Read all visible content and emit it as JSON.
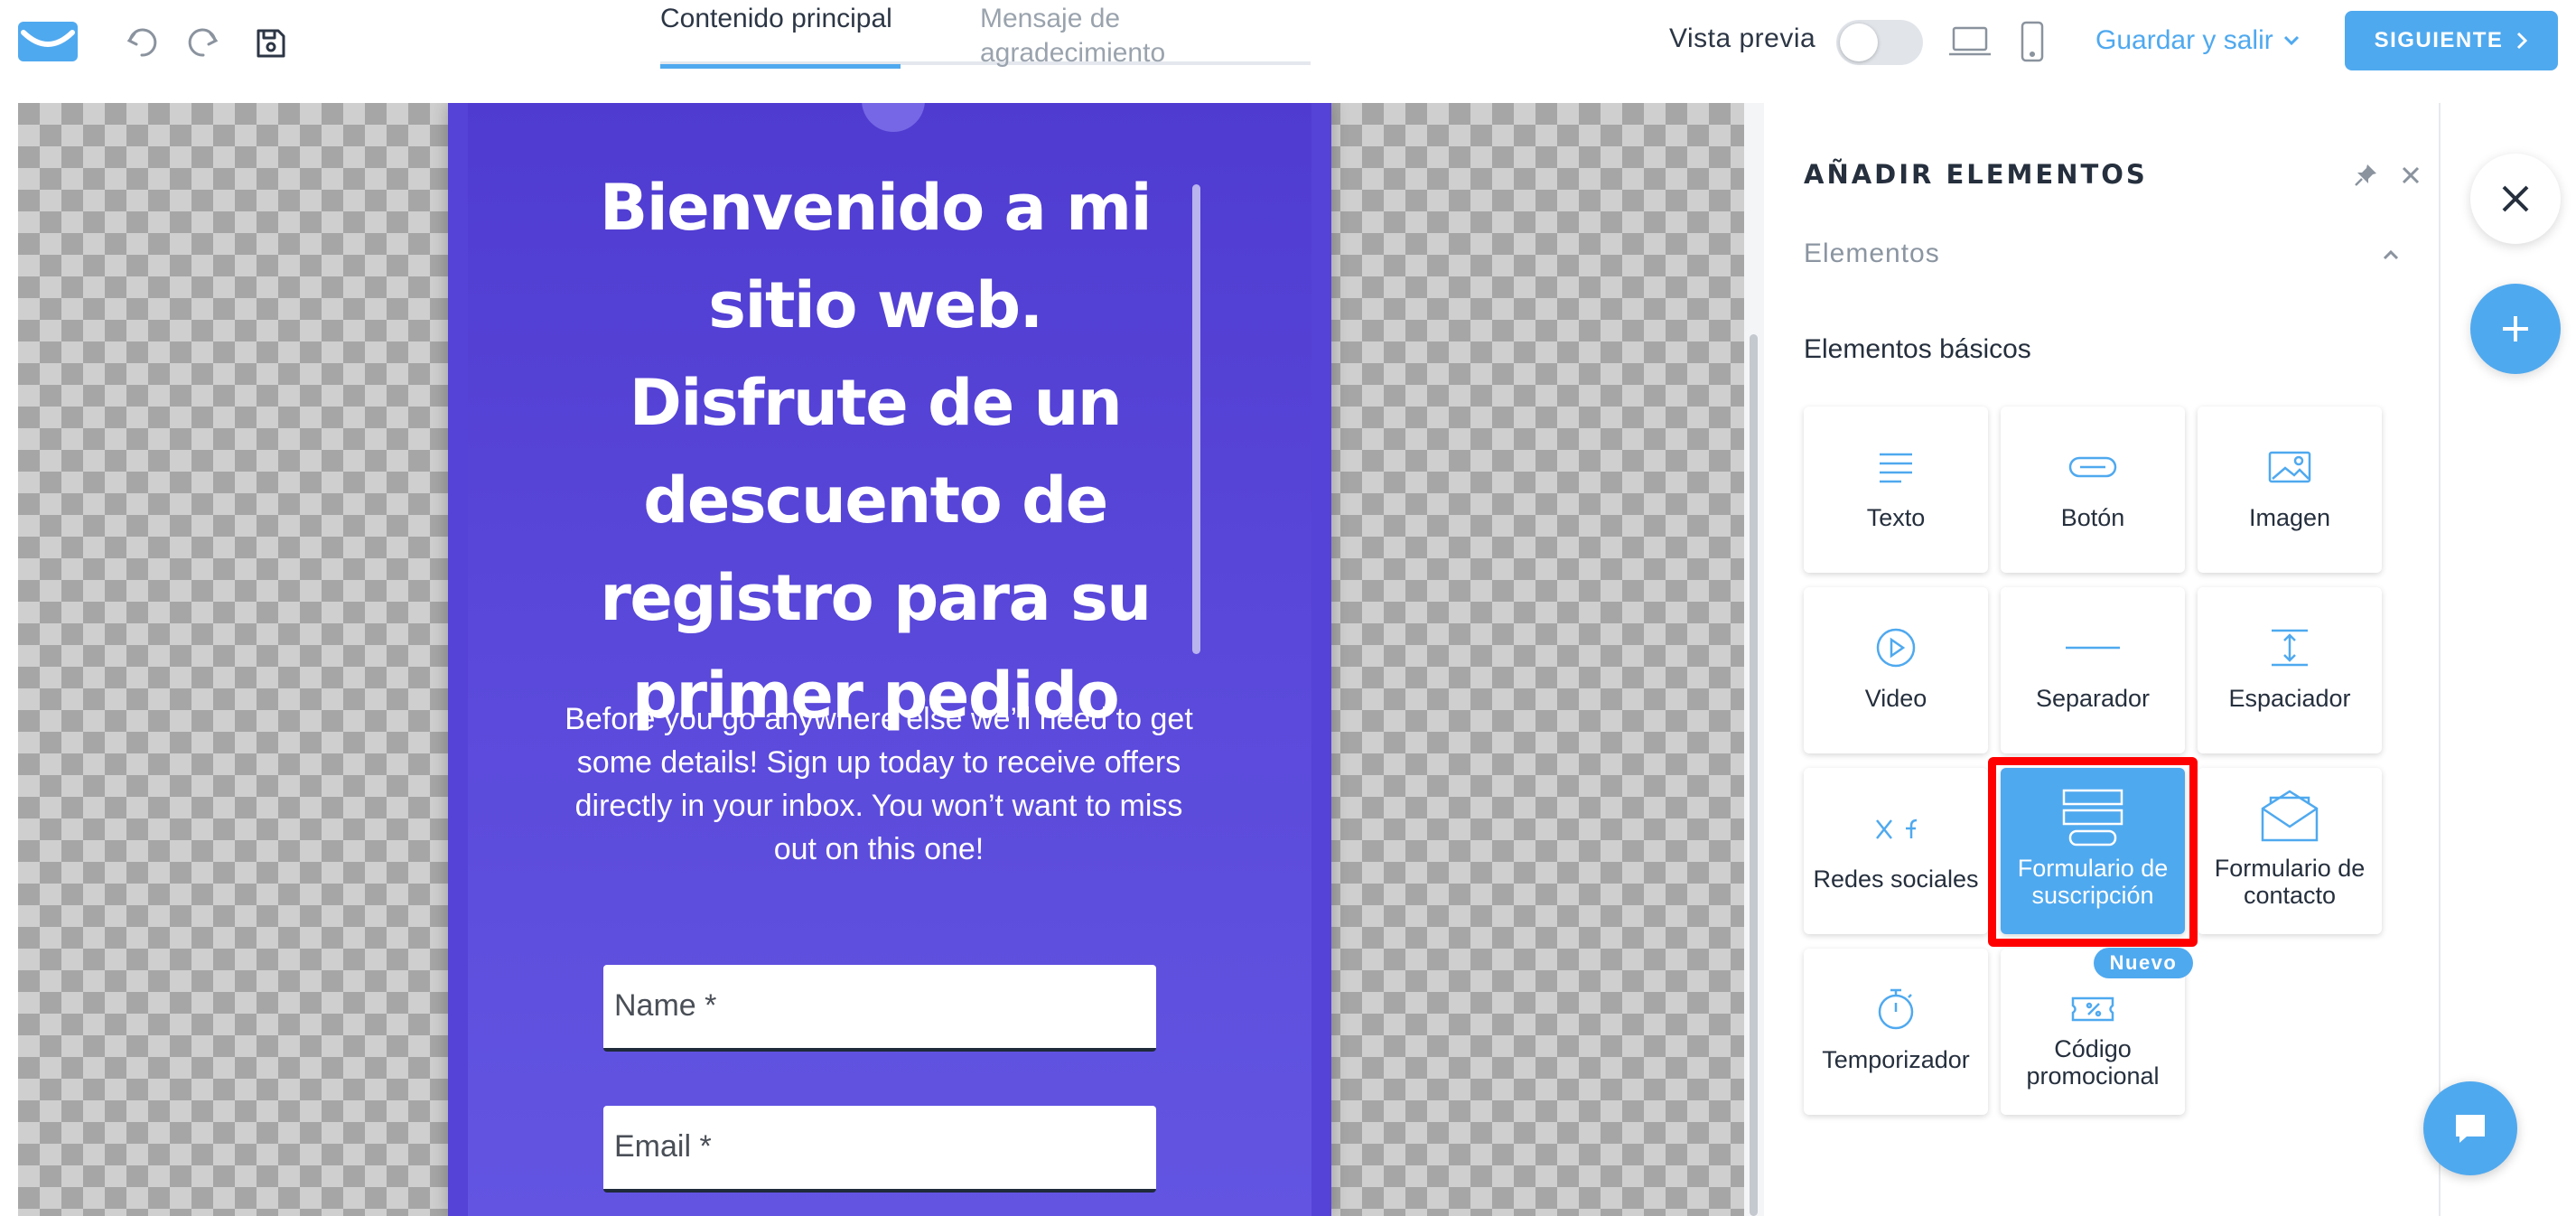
{
  "app": {
    "brand_color": "#4fa9ef",
    "popup_color": "#5542d6"
  },
  "toolbar": {
    "logo_icon": "getresponse-logo-icon",
    "undo_icon": "undo-icon",
    "redo_icon": "redo-icon",
    "save_icon": "floppy-save-icon"
  },
  "tabs": [
    {
      "label": "Contenido principal",
      "active": true
    },
    {
      "label": "Mensaje de agradecimiento",
      "active": false
    }
  ],
  "header": {
    "preview_label": "Vista previa",
    "preview_on": false,
    "save_exit_label": "Guardar y salir",
    "next_label": "SIGUIENTE"
  },
  "popup": {
    "headline": "Bienvenido a mi sitio web. Disfrute de un descuento de registro para su primer pedido",
    "body": "Before you go anywhere else we’ll need to get some details! Sign up today to receive offers directly in your inbox. You won’t want to miss out on this one!",
    "name_placeholder": "Name *",
    "email_placeholder": "Email *"
  },
  "panel": {
    "title": "AÑADIR ELEMENTOS",
    "section_label": "Elementos",
    "group_label": "Elementos básicos",
    "new_badge": "Nuevo",
    "tiles": [
      {
        "label": "Texto",
        "icon": "text-icon"
      },
      {
        "label": "Botón",
        "icon": "button-icon"
      },
      {
        "label": "Imagen",
        "icon": "image-icon"
      },
      {
        "label": "Video",
        "icon": "video-play-icon"
      },
      {
        "label": "Separador",
        "icon": "separator-icon"
      },
      {
        "label": "Espaciador",
        "icon": "spacer-icon"
      },
      {
        "label": "Redes sociales",
        "icon": "social-x-facebook-icon"
      },
      {
        "label": "Formulario de suscripción",
        "icon": "subscription-form-icon",
        "selected": true
      },
      {
        "label": "Formulario de contacto",
        "icon": "envelope-icon"
      },
      {
        "label": "Temporizador",
        "icon": "stopwatch-icon"
      },
      {
        "label": "Código promocional",
        "icon": "promo-ticket-icon"
      }
    ]
  }
}
